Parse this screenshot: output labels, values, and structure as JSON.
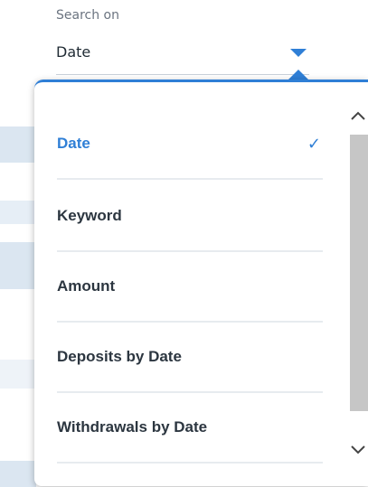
{
  "search": {
    "label": "Search on",
    "value": "Date"
  },
  "dropdown": {
    "options": [
      {
        "label": "Date",
        "selected": true
      },
      {
        "label": "Keyword",
        "selected": false
      },
      {
        "label": "Amount",
        "selected": false
      },
      {
        "label": "Deposits by Date",
        "selected": false
      },
      {
        "label": "Withdrawals by Date",
        "selected": false
      }
    ],
    "check_glyph": "✓"
  },
  "icons": {
    "caret": "chevron-down-icon",
    "check": "check-icon",
    "scroll_up": "chevron-up-icon",
    "scroll_down": "chevron-down-icon"
  },
  "colors": {
    "accent": "#2f7fd6",
    "text": "#1f2a33",
    "muted": "#6b7480"
  }
}
